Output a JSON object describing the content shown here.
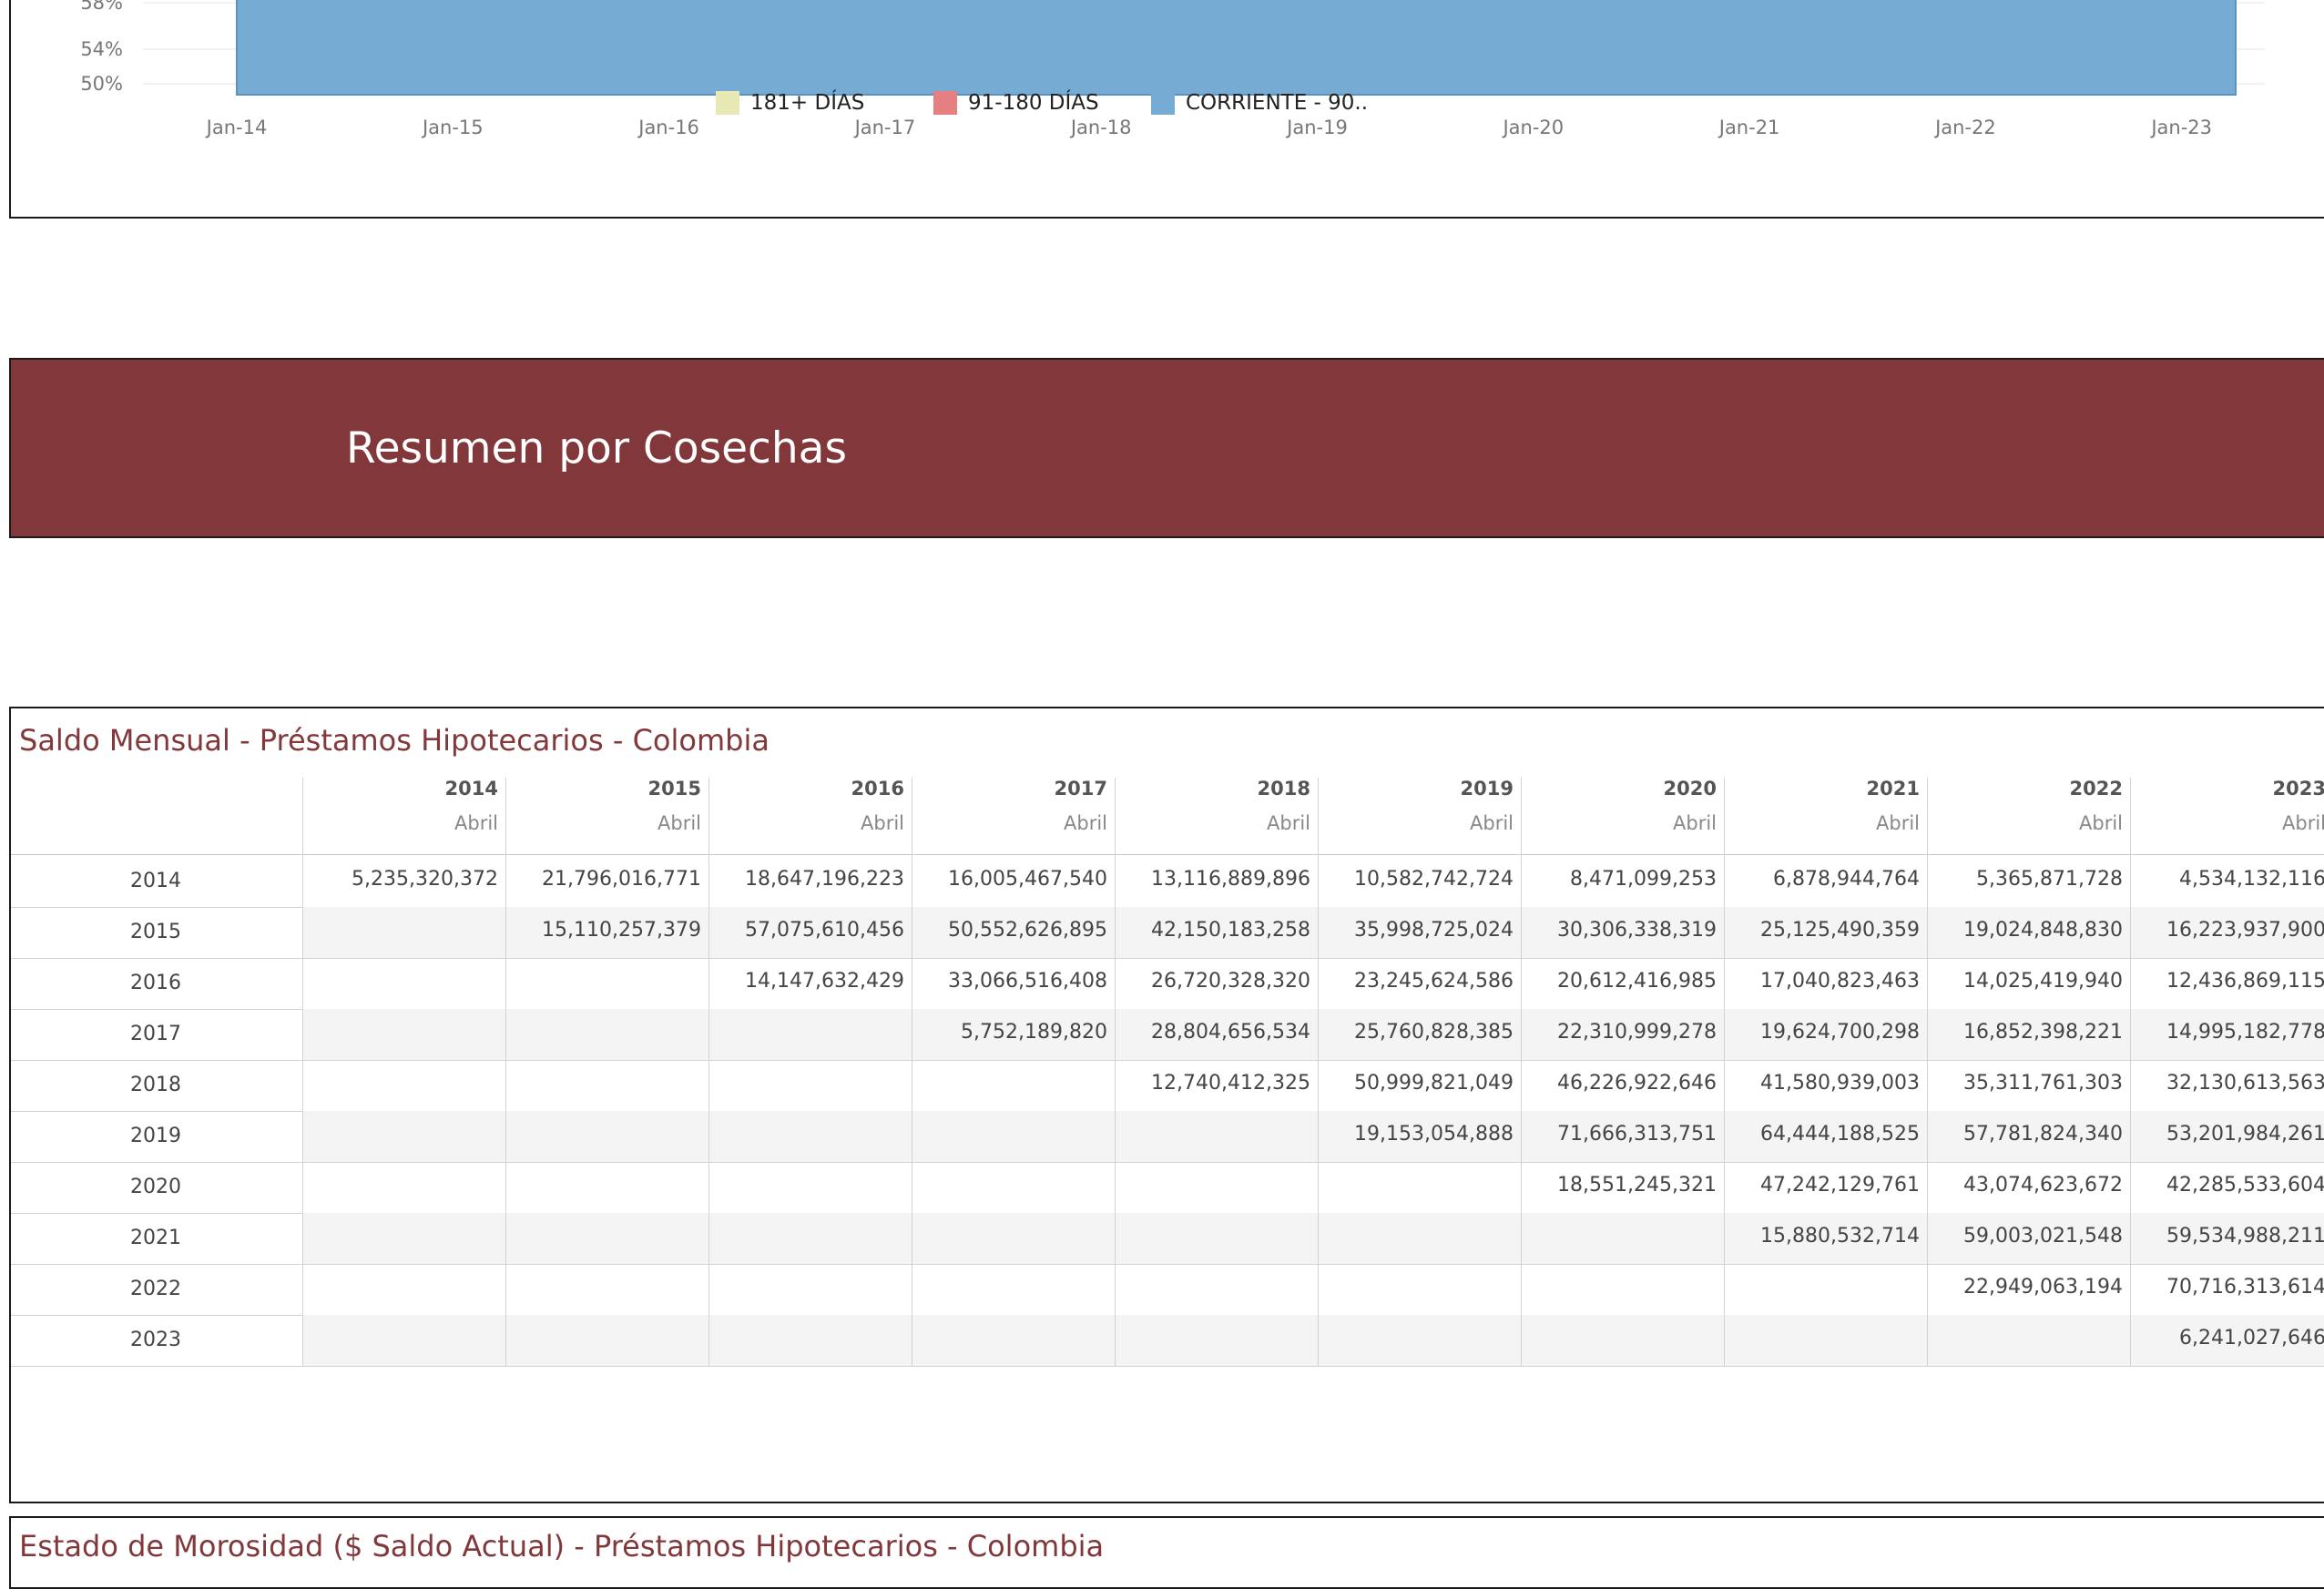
{
  "chart_data": {
    "type": "area",
    "y_tick_labels": [
      "58%",
      "54%",
      "50%"
    ],
    "x_tick_labels": [
      "Jan-14",
      "Jan-15",
      "Jan-16",
      "Jan-17",
      "Jan-18",
      "Jan-19",
      "Jan-20",
      "Jan-21",
      "Jan-22",
      "Jan-23"
    ],
    "visible_ylim": [
      50,
      58
    ],
    "series": [
      {
        "name": "181+ DÍAS",
        "color": "#e8e8b4"
      },
      {
        "name": "91-180 DÍAS",
        "color": "#e57f82"
      },
      {
        "name": "CORRIENTE - 90..",
        "color": "#76abd3",
        "x_range": [
          "Jan-14",
          "Apr-23"
        ]
      }
    ],
    "grid": true,
    "legend_placement": "bottom"
  },
  "banner": {
    "title": "Resumen por Cosechas"
  },
  "table": {
    "title": "Saldo Mensual - Préstamos Hipotecarios - Colombia",
    "columns": [
      {
        "year": "2014",
        "month": "Abril"
      },
      {
        "year": "2015",
        "month": "Abril"
      },
      {
        "year": "2016",
        "month": "Abril"
      },
      {
        "year": "2017",
        "month": "Abril"
      },
      {
        "year": "2018",
        "month": "Abril"
      },
      {
        "year": "2019",
        "month": "Abril"
      },
      {
        "year": "2020",
        "month": "Abril"
      },
      {
        "year": "2021",
        "month": "Abril"
      },
      {
        "year": "2022",
        "month": "Abril"
      },
      {
        "year": "2023",
        "month": "Abril"
      }
    ],
    "rows": [
      {
        "label": "2014",
        "cells": [
          "5,235,320,372",
          "21,796,016,771",
          "18,647,196,223",
          "16,005,467,540",
          "13,116,889,896",
          "10,582,742,724",
          "8,471,099,253",
          "6,878,944,764",
          "5,365,871,728",
          "4,534,132,116"
        ]
      },
      {
        "label": "2015",
        "cells": [
          "",
          "15,110,257,379",
          "57,075,610,456",
          "50,552,626,895",
          "42,150,183,258",
          "35,998,725,024",
          "30,306,338,319",
          "25,125,490,359",
          "19,024,848,830",
          "16,223,937,900"
        ]
      },
      {
        "label": "2016",
        "cells": [
          "",
          "",
          "14,147,632,429",
          "33,066,516,408",
          "26,720,328,320",
          "23,245,624,586",
          "20,612,416,985",
          "17,040,823,463",
          "14,025,419,940",
          "12,436,869,115"
        ]
      },
      {
        "label": "2017",
        "cells": [
          "",
          "",
          "",
          "5,752,189,820",
          "28,804,656,534",
          "25,760,828,385",
          "22,310,999,278",
          "19,624,700,298",
          "16,852,398,221",
          "14,995,182,778"
        ]
      },
      {
        "label": "2018",
        "cells": [
          "",
          "",
          "",
          "",
          "12,740,412,325",
          "50,999,821,049",
          "46,226,922,646",
          "41,580,939,003",
          "35,311,761,303",
          "32,130,613,563"
        ]
      },
      {
        "label": "2019",
        "cells": [
          "",
          "",
          "",
          "",
          "",
          "19,153,054,888",
          "71,666,313,751",
          "64,444,188,525",
          "57,781,824,340",
          "53,201,984,261"
        ]
      },
      {
        "label": "2020",
        "cells": [
          "",
          "",
          "",
          "",
          "",
          "",
          "18,551,245,321",
          "47,242,129,761",
          "43,074,623,672",
          "42,285,533,604"
        ]
      },
      {
        "label": "2021",
        "cells": [
          "",
          "",
          "",
          "",
          "",
          "",
          "",
          "15,880,532,714",
          "59,003,021,548",
          "59,534,988,211"
        ]
      },
      {
        "label": "2022",
        "cells": [
          "",
          "",
          "",
          "",
          "",
          "",
          "",
          "",
          "22,949,063,194",
          "70,716,313,614"
        ]
      },
      {
        "label": "2023",
        "cells": [
          "",
          "",
          "",
          "",
          "",
          "",
          "",
          "",
          "",
          "6,241,027,646"
        ]
      }
    ]
  },
  "bottom_panel": {
    "title": "Estado de Morosidad ($ Saldo Actual) - Préstamos Hipotecarios - Colombia"
  }
}
